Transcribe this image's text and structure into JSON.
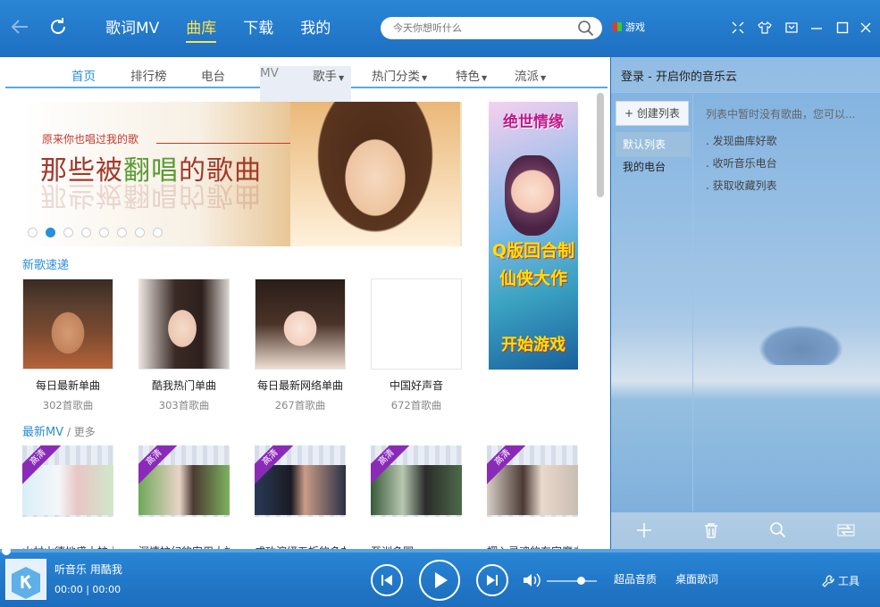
{
  "topnav": [
    "歌词MV",
    "曲库",
    "下载",
    "我的"
  ],
  "search": {
    "placeholder": "今天你想听什么"
  },
  "game_label": "游戏",
  "subnav": [
    "首页",
    "排行榜",
    "电台",
    "MV",
    "歌手",
    "热门分类",
    "特色",
    "流派"
  ],
  "banner": {
    "subtitle": "原来你也唱过我的歌",
    "title_a": "那些被",
    "title_b": "翻唱",
    "title_c": "的歌曲",
    "dots_total": 8,
    "dots_active": 2
  },
  "ad": {
    "title": "绝世情缘",
    "line1": "Q版回合制",
    "line2": "仙侠大作",
    "line3": "开始游戏"
  },
  "new_songs": {
    "title": "新歌速递",
    "items": [
      {
        "name": "每日最新单曲",
        "count": "302首歌曲"
      },
      {
        "name": "酷我热门单曲",
        "count": "303首歌曲"
      },
      {
        "name": "每日最新网络单曲",
        "count": "267首歌曲"
      },
      {
        "name": "中国好声音",
        "count": "672首歌曲"
      }
    ]
  },
  "mv": {
    "title": "最新MV",
    "more": "更多",
    "badge": "高清",
    "titles": [
      "山村山德地盛大护士",
      "深情护幻的安用大神",
      "成功演绎五折的多曲",
      "至训多园",
      "摆入灵魂的东家魔击"
    ]
  },
  "right": {
    "header": "登录 - 开启你的音乐云",
    "create": "创建列表",
    "items": [
      "默认列表",
      "我的电台"
    ],
    "tips": [
      "列表中暂时没有歌曲，您可以...",
      ". 发现曲库好歌",
      ". 收听音乐电台",
      ". 获取收藏列表"
    ]
  },
  "player": {
    "line1": "听音乐 用酷我",
    "time": "00:00 | 00:00",
    "quality": "超品音质",
    "lyrics": "桌面歌词",
    "tools": "工具",
    "volume": 0.7
  }
}
